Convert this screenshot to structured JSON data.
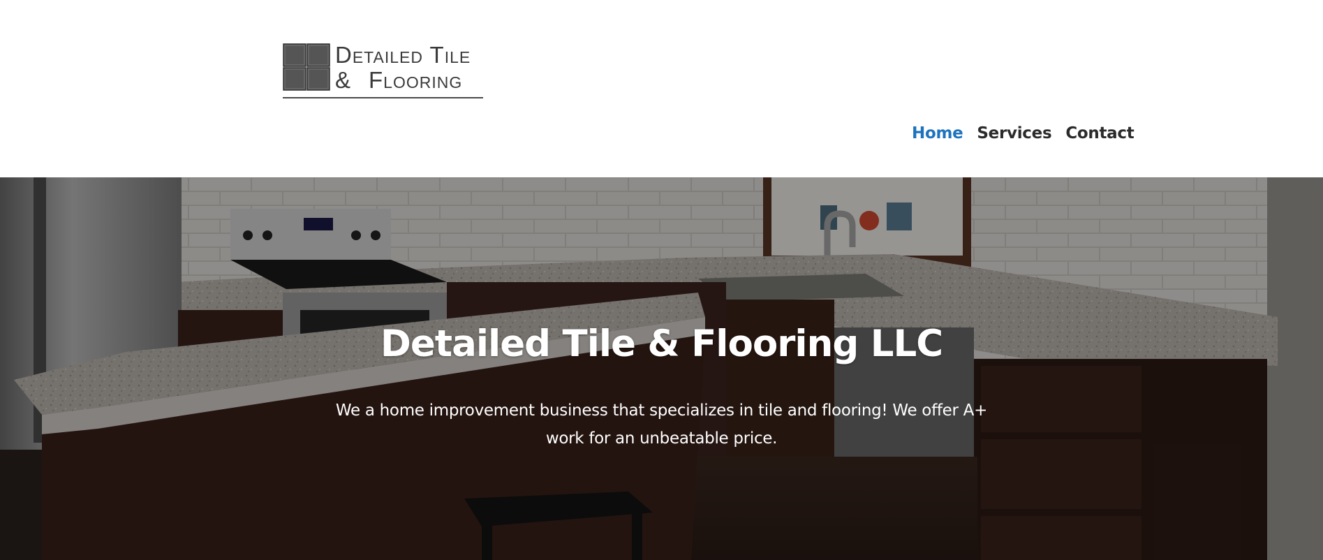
{
  "header": {
    "logo": {
      "line1": "Detailed Tile",
      "line2_amp": "&",
      "line2_word": "Flooring",
      "icon": "tile-grid-logo-icon"
    },
    "nav": {
      "items": [
        {
          "label": "Home",
          "active": true
        },
        {
          "label": "Services",
          "active": false
        },
        {
          "label": "Contact",
          "active": false
        }
      ]
    }
  },
  "hero": {
    "background": "kitchen-photo",
    "title": "Detailed Tile & Flooring LLC",
    "description": "We a home improvement business that specializes in tile and flooring! We offer A+ work for an unbeatable price."
  },
  "colors": {
    "nav_active": "#1e73be",
    "nav_text": "#2b2b2b",
    "logo_text": "#3a3a3a",
    "hero_text": "#ffffff"
  }
}
